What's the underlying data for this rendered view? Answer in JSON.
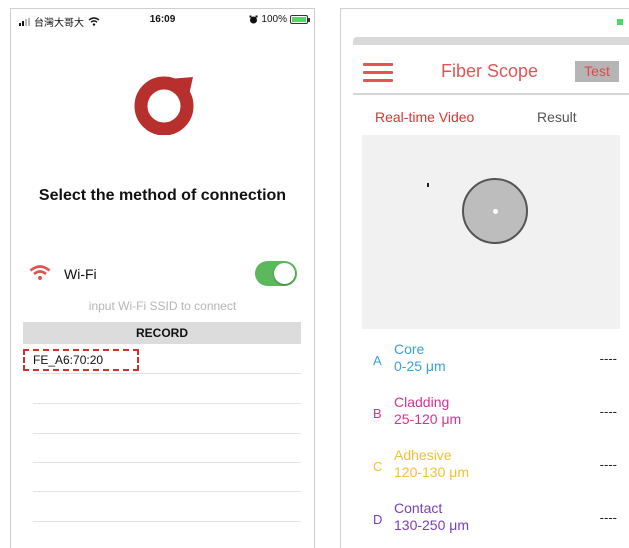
{
  "left": {
    "status": {
      "carrier": "台灣大哥大",
      "time": "16:09",
      "battery": "100%"
    },
    "heading": "Select the method of connection",
    "wifi": {
      "label": "Wi-Fi",
      "enabled": true
    },
    "ssid_hint": "input Wi-Fi SSID to connect",
    "record": {
      "title": "RECORD",
      "items": [
        "FE_A6:70:20"
      ]
    },
    "colors": {
      "accent": "#d0312d",
      "toggle_on": "#5cb85c"
    }
  },
  "right": {
    "title": "Fiber Scope",
    "test_label": "Test",
    "tabs": {
      "realtime": "Real-time Video",
      "result": "Result"
    },
    "zones": [
      {
        "letter": "A",
        "name": "Core",
        "range": "0-25 μm",
        "value": "----",
        "color": "#3aa0d8"
      },
      {
        "letter": "B",
        "name": "Cladding",
        "range": "25-120 μm",
        "value": "----",
        "color": "#d6338f"
      },
      {
        "letter": "C",
        "name": "Adhesive",
        "range": "120-130 μm",
        "value": "----",
        "color": "#efc231"
      },
      {
        "letter": "D",
        "name": "Contact",
        "range": "130-250 μm",
        "value": "----",
        "color": "#7a3fb5"
      }
    ],
    "colors": {
      "title": "#e05555",
      "tab_active": "#dd3333"
    }
  }
}
